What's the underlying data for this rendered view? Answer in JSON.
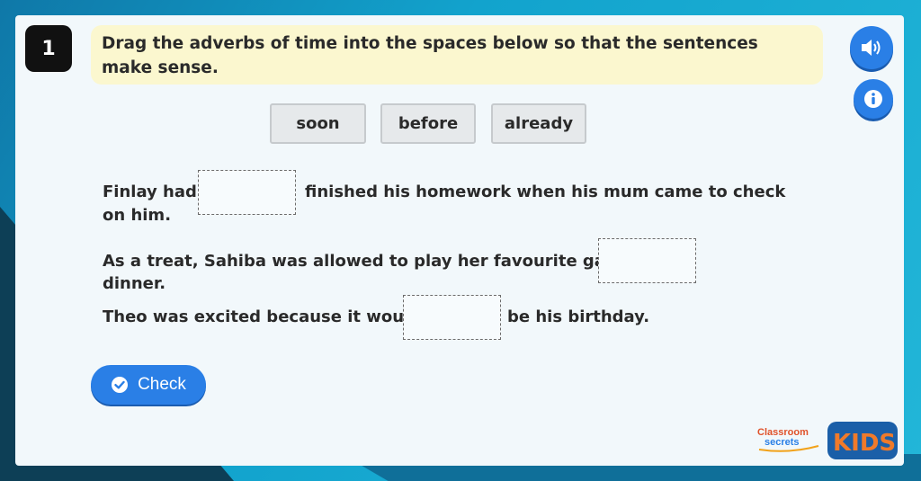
{
  "question": {
    "number": "1",
    "instruction": "Drag the adverbs of time into the spaces below so that the sentences make sense."
  },
  "word_bank": [
    "soon",
    "before",
    "already"
  ],
  "sentences": [
    {
      "before": "Finlay had",
      "after": "finished his homework when his mum came to check",
      "continuation": "on him."
    },
    {
      "before": "As a treat, Sahiba was allowed to play her favourite game",
      "continuation": "dinner."
    },
    {
      "before": "Theo was excited because it would",
      "after": "be his birthday."
    }
  ],
  "check_button": {
    "label": "Check"
  },
  "logo": {
    "brand_top": "Classroom",
    "brand_bottom": "secrets",
    "kids": "KIDS"
  },
  "colors": {
    "accent": "#2a7fe6",
    "instruction_bg": "#fbf7cf",
    "background": "#1aa6cf"
  },
  "icons": {
    "sound": "speaker-icon",
    "info": "info-icon",
    "check": "checkmark-circle-icon"
  }
}
